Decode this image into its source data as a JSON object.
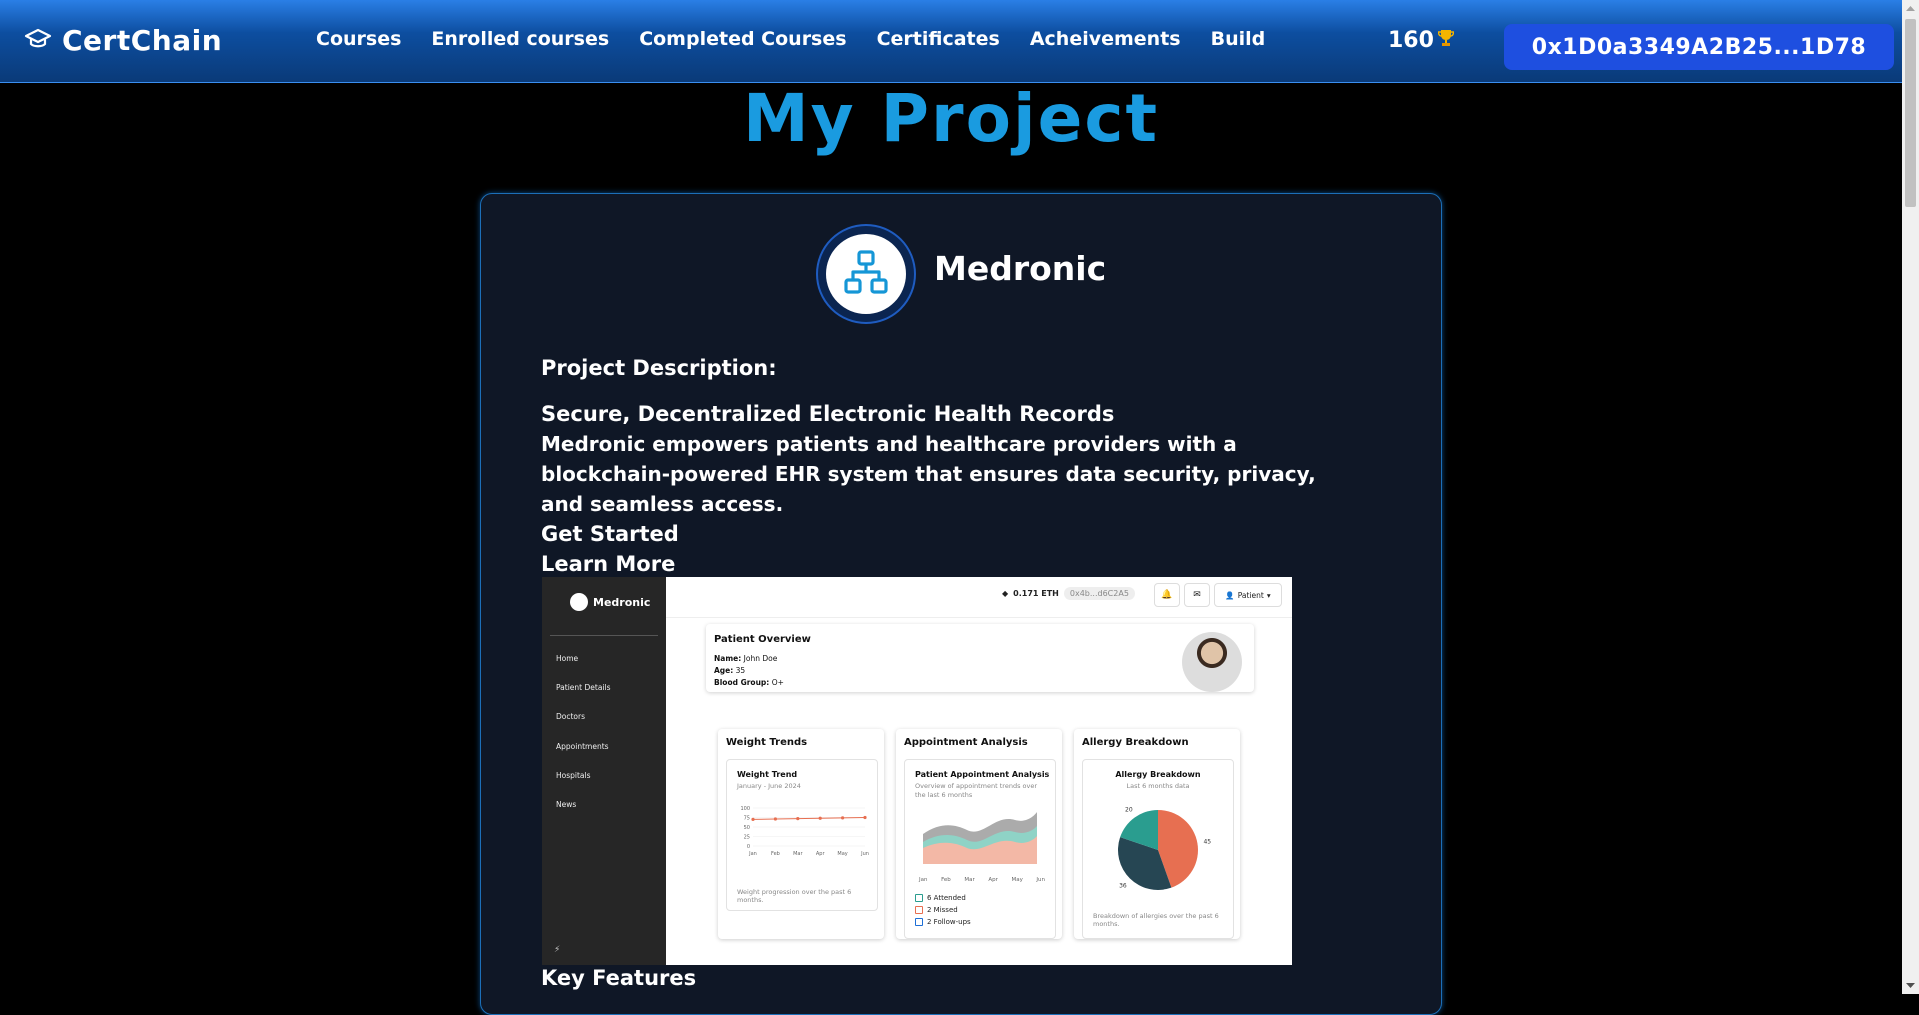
{
  "nav": {
    "brand": "CertChain",
    "links": [
      "Courses",
      "Enrolled courses",
      "Completed Courses",
      "Certificates",
      "Acheivements",
      "Build"
    ],
    "points": "160",
    "wallet": "0x1D0a3349A2B25...1D78"
  },
  "page": {
    "title": "My Project"
  },
  "project": {
    "name": "Medronic",
    "description_label": "Project Description:",
    "tagline": "Secure, Decentralized Electronic Health Records",
    "body": "Medronic empowers patients and healthcare providers with a blockchain-powered EHR system that ensures data security, privacy, and seamless access.",
    "cta_primary": "Get Started",
    "cta_secondary": "Learn More",
    "features_heading": "Key Features"
  },
  "screenshot": {
    "logo": "Medronic",
    "sidebar": [
      "Home",
      "Patient Details",
      "Doctors",
      "Appointments",
      "Hospitals",
      "News"
    ],
    "eth": "0.171 ETH",
    "address": "0x4b...d6C2A5",
    "user_menu": "Patient",
    "overview": {
      "title": "Patient Overview",
      "name_label": "Name:",
      "name": "John Doe",
      "age_label": "Age:",
      "age": "35",
      "blood_label": "Blood Group:",
      "blood": "O+"
    },
    "weight": {
      "panel_title": "Weight Trends",
      "title": "Weight Trend",
      "subtitle": "January - June 2024",
      "footer": "Weight progression over the past 6 months.",
      "months": [
        "Jan",
        "Feb",
        "Mar",
        "Apr",
        "May",
        "Jun"
      ],
      "ticks": [
        "100",
        "75",
        "50",
        "25",
        "0"
      ],
      "values": [
        70,
        71,
        72,
        73,
        74,
        75
      ]
    },
    "appointments": {
      "panel_title": "Appointment Analysis",
      "title": "Patient Appointment Analysis",
      "subtitle": "Overview of appointment trends over the last 6 months",
      "months": [
        "Jan",
        "Feb",
        "Mar",
        "Apr",
        "May",
        "Jun"
      ],
      "legend": [
        "6 Attended",
        "2 Missed",
        "2 Follow-ups"
      ]
    },
    "allergy": {
      "panel_title": "Allergy Breakdown",
      "title": "Allergy Breakdown",
      "subtitle": "Last 6 months data",
      "footer": "Breakdown of allergies over the past 6 months.",
      "slices": [
        {
          "value": 45,
          "color": "#e76f51"
        },
        {
          "value": 36,
          "color": "#264653"
        },
        {
          "value": 20,
          "color": "#2a9d8f"
        }
      ],
      "labels": [
        "45",
        "36",
        "20"
      ]
    }
  },
  "colors": {
    "accent": "#1a9be0",
    "wallet": "#1e4fe0",
    "card_border": "#1c6fb8"
  }
}
